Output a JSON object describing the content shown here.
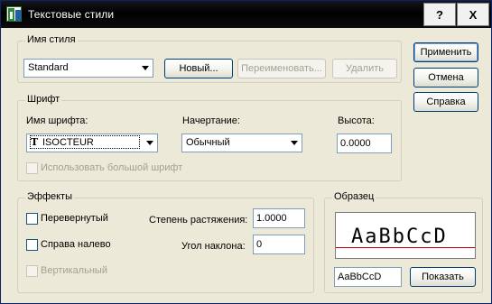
{
  "window": {
    "title": "Текстовые стили",
    "help_glyph": "?",
    "close_glyph": "X"
  },
  "style_group": {
    "legend": "Имя стиля",
    "style_value": "Standard",
    "new_button": "Новый...",
    "rename_button": "Переименовать...",
    "delete_button": "Удалить"
  },
  "buttons": {
    "apply": "Применить",
    "cancel": "Отмена",
    "help": "Справка"
  },
  "font_group": {
    "legend": "Шрифт",
    "font_name_label": "Имя шрифта:",
    "font_name_value": "ISOCTEUR",
    "font_type_glyph": "T",
    "style_label": "Начертание:",
    "style_value": "Обычный",
    "height_label": "Высота:",
    "height_value": "0.0000",
    "bigfont_label": "Использовать большой шрифт"
  },
  "effects_group": {
    "legend": "Эффекты",
    "upside_down": "Перевернутый",
    "backwards": "Справа налево",
    "vertical": "Вертикальный",
    "width_factor_label": "Степень растяжения:",
    "width_factor_value": "1.0000",
    "oblique_label": "Угол наклона:",
    "oblique_value": "0"
  },
  "preview_group": {
    "legend": "Образец",
    "preview_text": "AaBbCcD",
    "input_value": "AaBbCcD",
    "show_button": "Показать"
  }
}
